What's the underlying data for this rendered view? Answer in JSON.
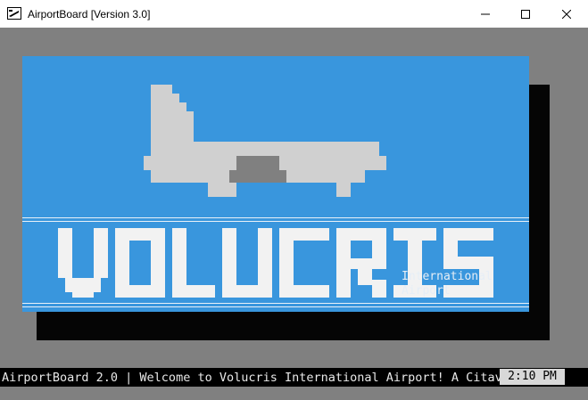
{
  "window": {
    "title": "AirportBoard [Version 3.0]",
    "controls": [
      "minimize",
      "maximize",
      "close"
    ]
  },
  "board": {
    "logo_text": "VOLUCRIS",
    "subtitle_line1": "International",
    "subtitle_line2": "Airport",
    "background_color": "#3996dd",
    "plane_color": "#d0d0d0",
    "plane_window_color": "#808080"
  },
  "status_bar": {
    "ticker": "AirportBoard 2.0 | Welcome to Volucris International Airport! A Citava",
    "clock": "2:10 PM"
  }
}
